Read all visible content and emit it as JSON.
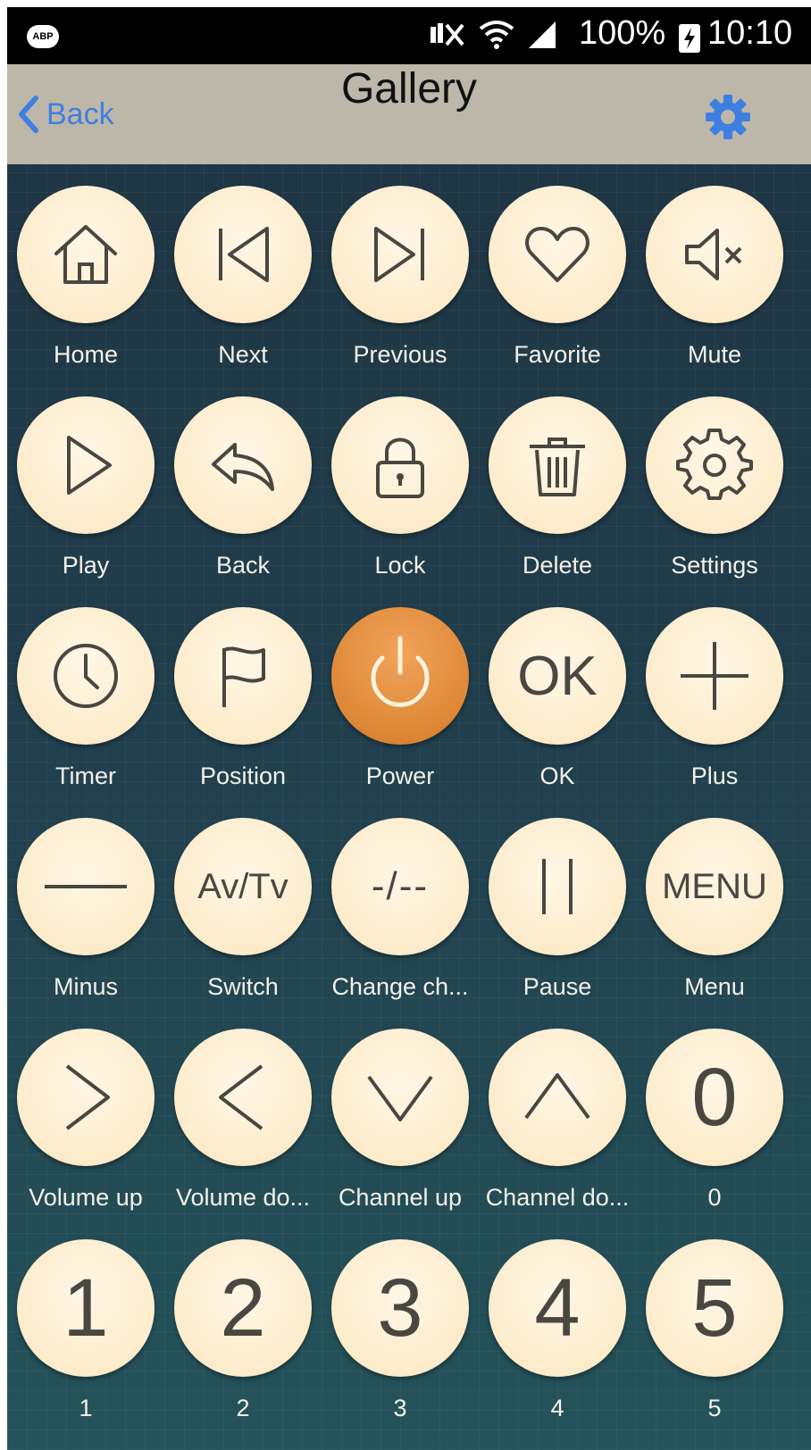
{
  "status_bar": {
    "adblock_label": "ABP",
    "battery": "100%",
    "time": "10:10"
  },
  "header": {
    "back_label": "Back",
    "title": "Gallery"
  },
  "buttons": [
    {
      "label": "Home",
      "icon": "home-icon"
    },
    {
      "label": "Next",
      "icon": "skip-previous-icon"
    },
    {
      "label": "Previous",
      "icon": "skip-next-icon"
    },
    {
      "label": "Favorite",
      "icon": "heart-icon"
    },
    {
      "label": "Mute",
      "icon": "mute-icon"
    },
    {
      "label": "Play",
      "icon": "play-icon"
    },
    {
      "label": "Back",
      "icon": "reply-arrow-icon"
    },
    {
      "label": "Lock",
      "icon": "lock-icon"
    },
    {
      "label": "Delete",
      "icon": "trash-icon"
    },
    {
      "label": "Settings",
      "icon": "gear-icon"
    },
    {
      "label": "Timer",
      "icon": "clock-icon"
    },
    {
      "label": "Position",
      "icon": "flag-icon"
    },
    {
      "label": "Power",
      "icon": "power-icon"
    },
    {
      "label": "OK",
      "icon_text": "OK"
    },
    {
      "label": "Plus",
      "icon": "plus-icon"
    },
    {
      "label": "Minus",
      "icon": "minus-icon"
    },
    {
      "label": "Switch",
      "icon_text": "Av/Tv"
    },
    {
      "label": "Change ch...",
      "icon_text": "-/--"
    },
    {
      "label": "Pause",
      "icon": "pause-icon"
    },
    {
      "label": "Menu",
      "icon_text": "MENU"
    },
    {
      "label": "Volume up",
      "icon": "chevron-right-icon"
    },
    {
      "label": "Volume do...",
      "icon": "chevron-left-icon"
    },
    {
      "label": "Channel up",
      "icon": "chevron-down-icon"
    },
    {
      "label": "Channel do...",
      "icon": "chevron-up-icon"
    },
    {
      "label": "0",
      "icon_text": "0"
    },
    {
      "label": "1",
      "icon_text": "1"
    },
    {
      "label": "2",
      "icon_text": "2"
    },
    {
      "label": "3",
      "icon_text": "3"
    },
    {
      "label": "4",
      "icon_text": "4"
    },
    {
      "label": "5",
      "icon_text": "5"
    }
  ],
  "colors": {
    "accent": "#3f7fe0",
    "button_face": "#fdeccb",
    "power_button": "#de8836",
    "navbar": "#bdb7aa"
  }
}
